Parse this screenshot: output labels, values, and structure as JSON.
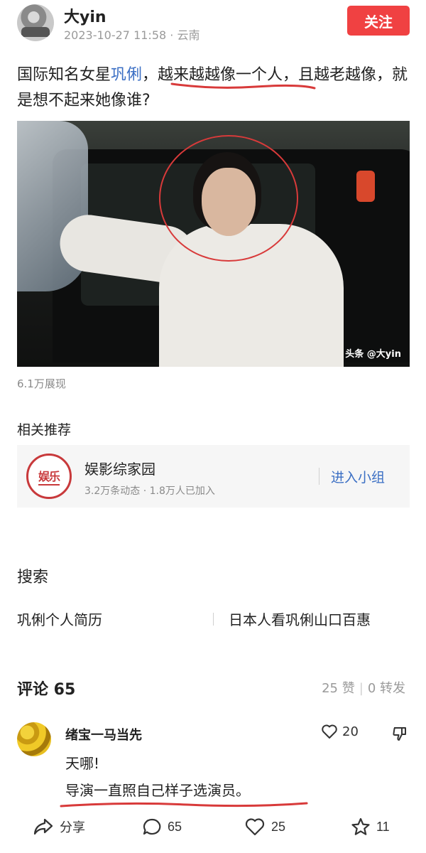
{
  "header": {
    "author_name": "大yin",
    "post_date": "2023-10-27 11:58",
    "location": "云南",
    "follow_label": "关注"
  },
  "post": {
    "text_part1": "国际知名女星",
    "text_link": "巩俐",
    "text_part2": "，越来越越像一个人，且越老越像，就是想不起来她像谁?",
    "image_watermark": "头条 @大yin",
    "view_count": "6.1万展现"
  },
  "related": {
    "title": "相关推荐",
    "group": {
      "logo_text": "娱乐",
      "name": "娱影综家园",
      "stats": "3.2万条动态 · 1.8万人已加入",
      "join_label": "进入小组"
    }
  },
  "search": {
    "title": "搜索",
    "suggestions": [
      "巩俐个人简历",
      "日本人看巩俐山口百惠"
    ]
  },
  "comments": {
    "title": "评论 65",
    "likes_text": "25 赞",
    "shares_text": "0 转发",
    "items": [
      {
        "user": "绪宝一马当先",
        "like_count": "20",
        "line1": "天哪!",
        "line2": "导演一直照自己样子选演员。"
      }
    ]
  },
  "action_bar": {
    "share_label": "分享",
    "comment_count": "65",
    "like_count": "25",
    "favorite_count": "11"
  },
  "colors": {
    "accent_red": "#f04142",
    "link_blue": "#3b6fc4",
    "annotation_red": "#d83a3a"
  },
  "icons": [
    "share-icon",
    "comment-icon",
    "heart-icon",
    "star-icon",
    "thumbs-down-icon"
  ]
}
